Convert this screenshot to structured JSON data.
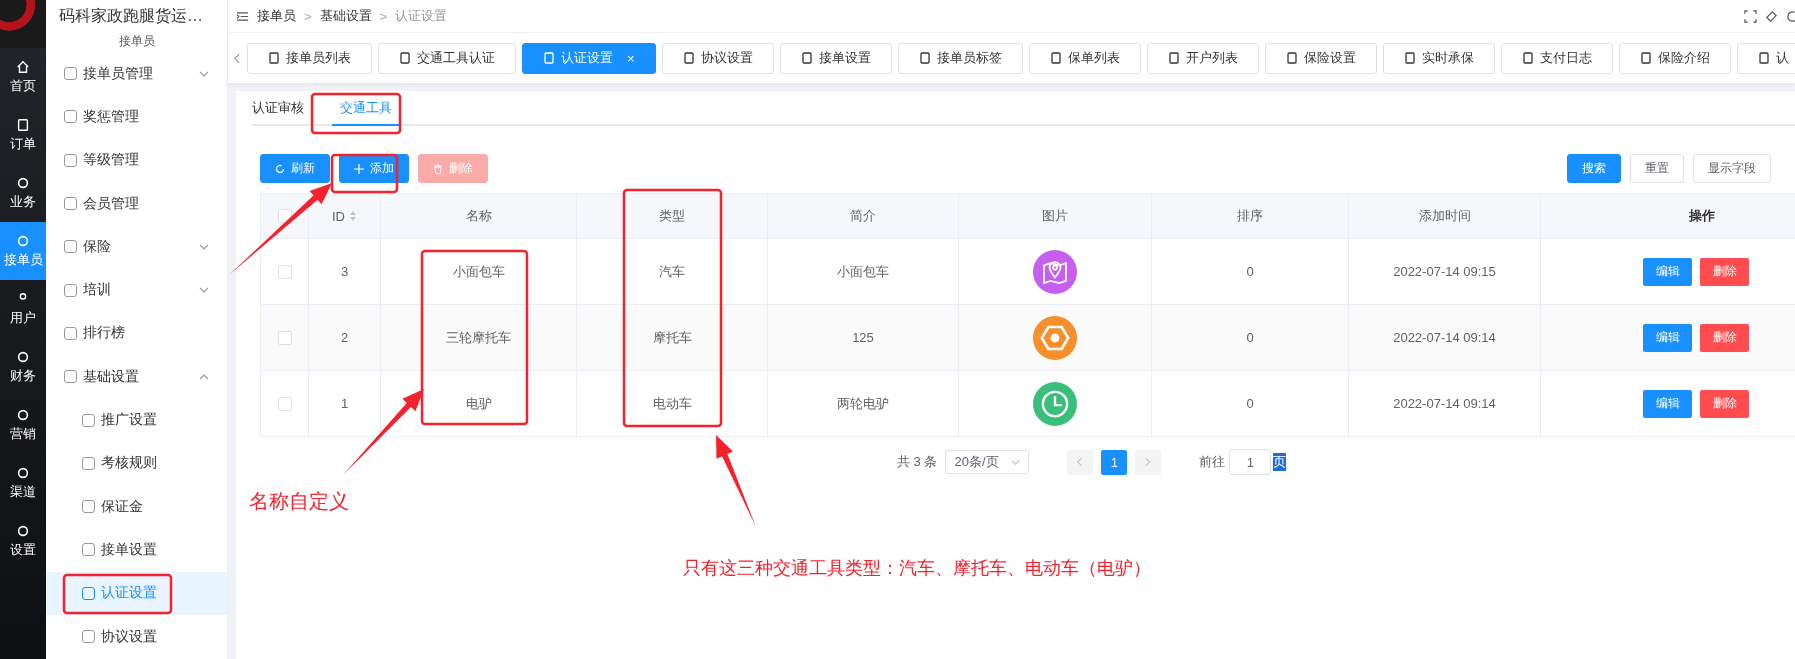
{
  "rail": {
    "items": [
      {
        "label": "首页",
        "selected": false
      },
      {
        "label": "订单",
        "selected": false
      },
      {
        "label": "业务",
        "selected": false
      },
      {
        "label": "接单员",
        "selected": true
      },
      {
        "label": "用户",
        "selected": false
      },
      {
        "label": "财务",
        "selected": false
      },
      {
        "label": "营销",
        "selected": false
      },
      {
        "label": "渠道",
        "selected": false
      },
      {
        "label": "设置",
        "selected": false
      }
    ]
  },
  "sidebar": {
    "title": "码科家政跑腿货运…",
    "section": "接单员",
    "items": [
      {
        "label": "接单员管理",
        "expanded": false,
        "selected": false
      },
      {
        "label": "奖惩管理",
        "selected": false
      },
      {
        "label": "等级管理",
        "selected": false
      },
      {
        "label": "会员管理",
        "selected": false
      },
      {
        "label": "保险",
        "expanded": false,
        "selected": false
      },
      {
        "label": "培训",
        "expanded": false,
        "selected": false
      },
      {
        "label": "排行榜",
        "selected": false
      },
      {
        "label": "基础设置",
        "expanded": true,
        "selected": false,
        "children": [
          {
            "label": "推广设置",
            "selected": false
          },
          {
            "label": "考核规则",
            "selected": false
          },
          {
            "label": "保证金",
            "selected": false
          },
          {
            "label": "接单设置",
            "selected": false
          },
          {
            "label": "认证设置",
            "selected": true
          },
          {
            "label": "协议设置",
            "selected": false
          }
        ]
      }
    ]
  },
  "breadcrumb": [
    {
      "label": "接单员"
    },
    {
      "separator": ">",
      "label": "基础设置"
    },
    {
      "separator": ">",
      "label": "认证设置"
    }
  ],
  "tabs": [
    {
      "label": "接单员列表",
      "selected": false
    },
    {
      "label": "交通工具认证",
      "selected": false
    },
    {
      "label": "认证设置",
      "selected": true,
      "close_label": "×"
    },
    {
      "label": "协议设置",
      "selected": false
    },
    {
      "label": "接单设置",
      "selected": false
    },
    {
      "label": "接单员标签",
      "selected": false
    },
    {
      "label": "保单列表",
      "selected": false
    },
    {
      "label": "开户列表",
      "selected": false
    },
    {
      "label": "保险设置",
      "selected": false
    },
    {
      "label": "实时承保",
      "selected": false
    },
    {
      "label": "支付日志",
      "selected": false
    },
    {
      "label": "保险介绍",
      "selected": false
    },
    {
      "label": "认",
      "selected": false
    }
  ],
  "subtabs": [
    {
      "label": "认证审核",
      "selected": false
    },
    {
      "label": "交通工具",
      "selected": true
    }
  ],
  "toolbar": {
    "left": [
      {
        "label": "刷新",
        "kind": "refresh",
        "disabled": false
      },
      {
        "label": "添加",
        "kind": "add",
        "disabled": false
      },
      {
        "label": "删除",
        "kind": "delete",
        "disabled": true
      }
    ],
    "right": [
      {
        "label": "搜索",
        "kind": "primary"
      },
      {
        "label": "重置",
        "kind": "plain"
      },
      {
        "label": "显示字段",
        "kind": "plain"
      }
    ]
  },
  "table": {
    "select_all_checked": false,
    "columns": [
      {
        "label": "ID",
        "sortable": true
      },
      {
        "label": "名称",
        "sortable": false
      },
      {
        "label": "类型",
        "sortable": false
      },
      {
        "label": "简介",
        "sortable": false
      },
      {
        "label": "图片",
        "sortable": false
      },
      {
        "label": "排序",
        "sortable": false
      },
      {
        "label": "添加时间",
        "sortable": false
      },
      {
        "label": "操作",
        "sortable": false
      }
    ],
    "rows": [
      {
        "checked": false,
        "id": "3",
        "name": "小面包车",
        "type": "汽车",
        "intro": "小面包车",
        "image": {
          "kind": "pin",
          "color": "#c65ff0"
        },
        "sort": "0",
        "time": "2022-07-14 09:15",
        "actions": [
          "编辑",
          "删除"
        ]
      },
      {
        "checked": false,
        "id": "2",
        "name": "三轮摩托车",
        "type": "摩托车",
        "intro": "125",
        "image": {
          "kind": "nut",
          "color": "#f7902c"
        },
        "sort": "0",
        "time": "2022-07-14 09:14",
        "actions": [
          "编辑",
          "删除"
        ]
      },
      {
        "checked": false,
        "id": "1",
        "name": "电驴",
        "type": "电动车",
        "intro": "两轮电驴",
        "image": {
          "kind": "clock",
          "color": "#38bf7a"
        },
        "sort": "0",
        "time": "2022-07-14 09:14",
        "actions": [
          "编辑",
          "删除"
        ]
      }
    ]
  },
  "pagination": {
    "total": "共 3 条",
    "page_size": "20条/页",
    "pages": [
      {
        "label": "1",
        "selected": true
      }
    ],
    "goto_label": "前往",
    "goto_value": "1",
    "goto_suffix": "页"
  },
  "annotations": [
    "名称自定义",
    "只有这三种交通工具类型：汽车、摩托车、电动车（电驴）"
  ]
}
